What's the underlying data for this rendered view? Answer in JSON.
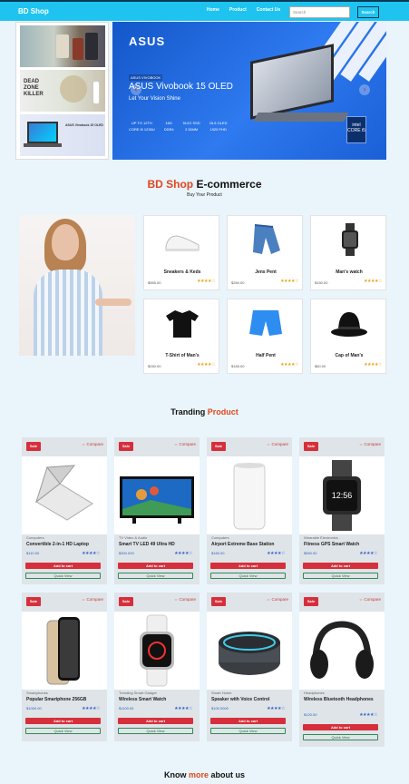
{
  "nav": {
    "brand": "BD Shop",
    "links": [
      "Home",
      "Product",
      "Contact Us"
    ],
    "search_placeholder": "Search",
    "search_button": "Search"
  },
  "carousel": {
    "thumb2_text": "DEAD ZONE KILLER",
    "thumb3_text": "ASUS Vivobook 15 OLED",
    "brand": "ASUS",
    "tag": "ASUS VIVOBOOK",
    "title": "ASUS Vivobook 15 OLED",
    "subtitle": "Let Your Vision Shine",
    "specs": [
      {
        "top": "UP TO 12TH",
        "bottom": "CORE i5 1235U"
      },
      {
        "top": "16G",
        "bottom": "DDR4"
      },
      {
        "top": "512G SSD",
        "bottom": "2 DIMM"
      },
      {
        "top": "15.6 OLED",
        "bottom": "1920 FHD"
      }
    ],
    "badge": "intel CORE i5",
    "prev": "‹",
    "next": "›"
  },
  "intro": {
    "title_part1": "BD Shop",
    "title_part2": " E-commerce",
    "subtitle": "Buy Your Product"
  },
  "products": [
    {
      "name": "Sneakers & Keds",
      "price": "$565.00",
      "stars": "★★★★☆",
      "icon": "sneaker-icon"
    },
    {
      "name": "Jens Pent",
      "price": "$260.00",
      "stars": "★★★★☆",
      "icon": "jeans-icon"
    },
    {
      "name": "Man's watch",
      "price": "$150.00",
      "stars": "★★★★☆",
      "icon": "smartwatch-icon"
    },
    {
      "name": "T-Shirt of Man's",
      "price": "$260.00",
      "stars": "★★★★☆",
      "icon": "tshirt-icon"
    },
    {
      "name": "Half Pent",
      "price": "$165.00",
      "stars": "★★★★☆",
      "icon": "shorts-icon"
    },
    {
      "name": "Cap of Man's",
      "price": "$60.00",
      "stars": "★★★★☆",
      "icon": "hat-icon"
    }
  ],
  "trending": {
    "title_part1": "Tranding ",
    "title_part2": "Product",
    "sale_label": "Sale",
    "compare_label": "⇔ Compare",
    "add_label": "Add to cart",
    "quick_label": "Quick View",
    "items": [
      {
        "category": "Computers",
        "name": "Convertible 2-in-1 HD Laptop",
        "price": "$110.00",
        "stars": "★★★★☆",
        "icon": "laptop-icon"
      },
      {
        "category": "TV Video & Audio",
        "name": "Smart TV LED 49 Ultra HD",
        "price": "$300.000",
        "stars": "★★★★☆",
        "icon": "tv-icon"
      },
      {
        "category": "Computers",
        "name": "Airport Extreme Base Station",
        "price": "$160.00",
        "stars": "★★★★☆",
        "icon": "router-icon"
      },
      {
        "category": "Wearable Electronics",
        "name": "Fitness GPS Smart Watch",
        "price": "$550.00",
        "stars": "★★★★☆",
        "icon": "watch-icon"
      },
      {
        "category": "Smartphones",
        "name": "Popular Smartphone 256GB",
        "price": "$1000.00",
        "stars": "★★★★☆",
        "icon": "phone-icon"
      },
      {
        "category": "Trending Smart Gadget",
        "name": "Wireless Smart Watch",
        "price": "$1100.00",
        "stars": "★★★★☆",
        "icon": "watch-icon"
      },
      {
        "category": "Smart Home",
        "name": "Speaker with Voice Control",
        "price": "$100.0000",
        "stars": "★★★★☆",
        "icon": "speaker-icon"
      },
      {
        "category": "Headphones",
        "name": "Wireless Bluetooth Headphones",
        "price": "$120.00",
        "stars": "★★★★☆",
        "icon": "headphones-icon"
      }
    ]
  },
  "know": {
    "part1": "Know ",
    "part2": "more",
    "part3": " about us"
  }
}
